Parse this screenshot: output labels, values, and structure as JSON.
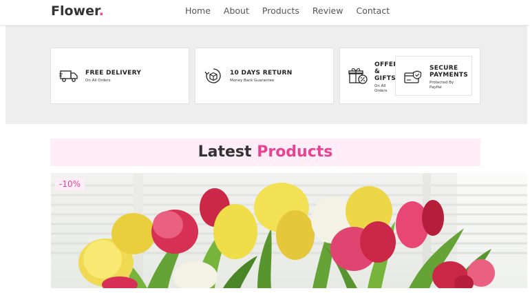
{
  "header": {
    "logo_text": "Flower",
    "logo_dot": ".",
    "nav": [
      "Home",
      "About",
      "Products",
      "Review",
      "Contact"
    ]
  },
  "features": [
    {
      "icon": "delivery-truck-icon",
      "title": "FREE DELIVERY",
      "subtitle": "On All Orders"
    },
    {
      "icon": "return-box-icon",
      "title": "10 DAYS RETURN",
      "subtitle": "Money Back Guarantee"
    },
    {
      "icon": "gift-percent-icon",
      "title": "OFFER & GIFTS",
      "subtitle": "On All Orders"
    },
    {
      "icon": "secure-card-icon",
      "title": "SECURE PAYMENTS",
      "subtitle": "Protected By PayPal"
    }
  ],
  "latest": {
    "title_part1": "Latest",
    "title_part2": "Products"
  },
  "product": {
    "discount": "-10%",
    "image": "tulips-bouquet"
  },
  "colors": {
    "accent": "#e84393",
    "banner_bg": "#ffeef7",
    "band_bg": "#eeeeee"
  }
}
